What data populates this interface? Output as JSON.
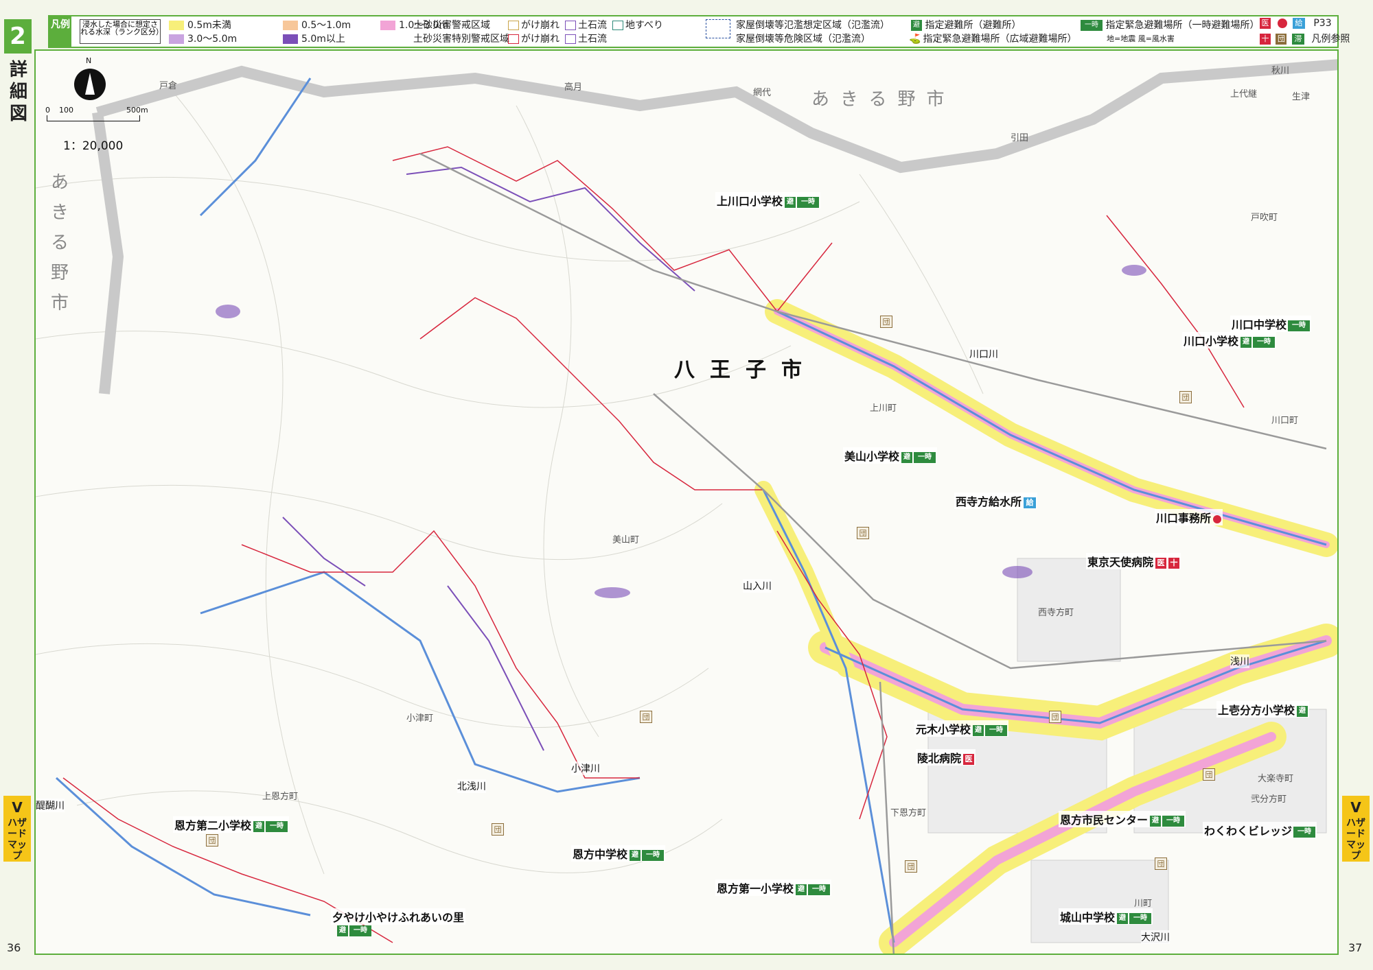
{
  "page": {
    "section_number": "2",
    "section_label": "詳細図",
    "page_left": "36",
    "page_right": "37",
    "side_tab": {
      "letter": "V",
      "label": "ハザードマップ"
    }
  },
  "legend": {
    "tag": "凡例",
    "depth_title": "浸水した場合に想定される水深（ランク区分）",
    "depth_ranks": [
      {
        "label": "0.5m未満",
        "color": "#f7ef7a"
      },
      {
        "label": "0.5〜1.0m",
        "color": "#f7c79a"
      },
      {
        "label": "1.0〜3.0m",
        "color": "#f2a4d6"
      },
      {
        "label": "3.0〜5.0m",
        "color": "#c9a4e0"
      },
      {
        "label": "5.0m以上",
        "color": "#7b4fb8"
      }
    ],
    "sediment_warning": "土砂災害警戒区域",
    "sediment_special": "土砂災害特別警戒区域",
    "sediment_types": [
      "がけ崩れ",
      "土石流",
      "地すべり"
    ],
    "flood_collapse_expected": "家屋倒壊等氾濫想定区域（氾濫流）",
    "flood_collapse_danger": "家屋倒壊等危険区域（氾濫流）",
    "designated_shelter": "指定避難所（避難所）",
    "emergency_wide": "指定緊急避難場所（広域避難場所）",
    "emergency_temp": "指定緊急避難場所（一時避難場所）",
    "disaster_note": "地=地震 風=風水害",
    "icons": [
      "医",
      "給",
      "団",
      "滞"
    ],
    "ref_page": "P33",
    "ref_note": "凡例参照"
  },
  "map": {
    "scale_text": "1：20,000",
    "scale_ticks": [
      "0",
      "100",
      "500m"
    ],
    "north": "N",
    "cities": {
      "main": "八王子市",
      "neighbor_top": "あきる野市",
      "neighbor_left": "あきる野市"
    },
    "towns": [
      "上川町",
      "美山町",
      "小津町",
      "上恩方町",
      "下恩方町",
      "西寺方町",
      "川口町",
      "戸吹町",
      "高月",
      "網代",
      "引田",
      "上代継",
      "秋川",
      "生津",
      "大楽寺町",
      "弐分方町",
      "川町",
      "戸倉"
    ],
    "rivers": [
      "川口川",
      "山入川",
      "浅川",
      "醍醐川",
      "北浅川",
      "小津川",
      "大沢川"
    ],
    "facilities": [
      {
        "name": "上川口小学校",
        "type": "shelter"
      },
      {
        "name": "川口中学校",
        "type": "shelter"
      },
      {
        "name": "川口小学校",
        "type": "shelter"
      },
      {
        "name": "美山小学校",
        "type": "shelter"
      },
      {
        "name": "西寺方給水所",
        "type": "water"
      },
      {
        "name": "川口事務所",
        "type": "office"
      },
      {
        "name": "東京天使病院",
        "type": "hospital"
      },
      {
        "name": "元木小学校",
        "type": "shelter"
      },
      {
        "name": "上壱分方小学校",
        "type": "shelter"
      },
      {
        "name": "陵北病院",
        "type": "hospital"
      },
      {
        "name": "恩方市民センター",
        "type": "shelter"
      },
      {
        "name": "わくわくビレッジ",
        "type": "shelter"
      },
      {
        "name": "恩方第二小学校",
        "type": "shelter"
      },
      {
        "name": "恩方中学校",
        "type": "shelter"
      },
      {
        "name": "恩方第一小学校",
        "type": "shelter"
      },
      {
        "name": "夕やけ小やけふれあいの里",
        "type": "shelter"
      },
      {
        "name": "城山中学校",
        "type": "shelter"
      }
    ],
    "icon_labels": {
      "shelter": "避",
      "temp": "一時",
      "hospital": "医",
      "water": "給",
      "danchi": "団",
      "red_cross": "十"
    }
  }
}
